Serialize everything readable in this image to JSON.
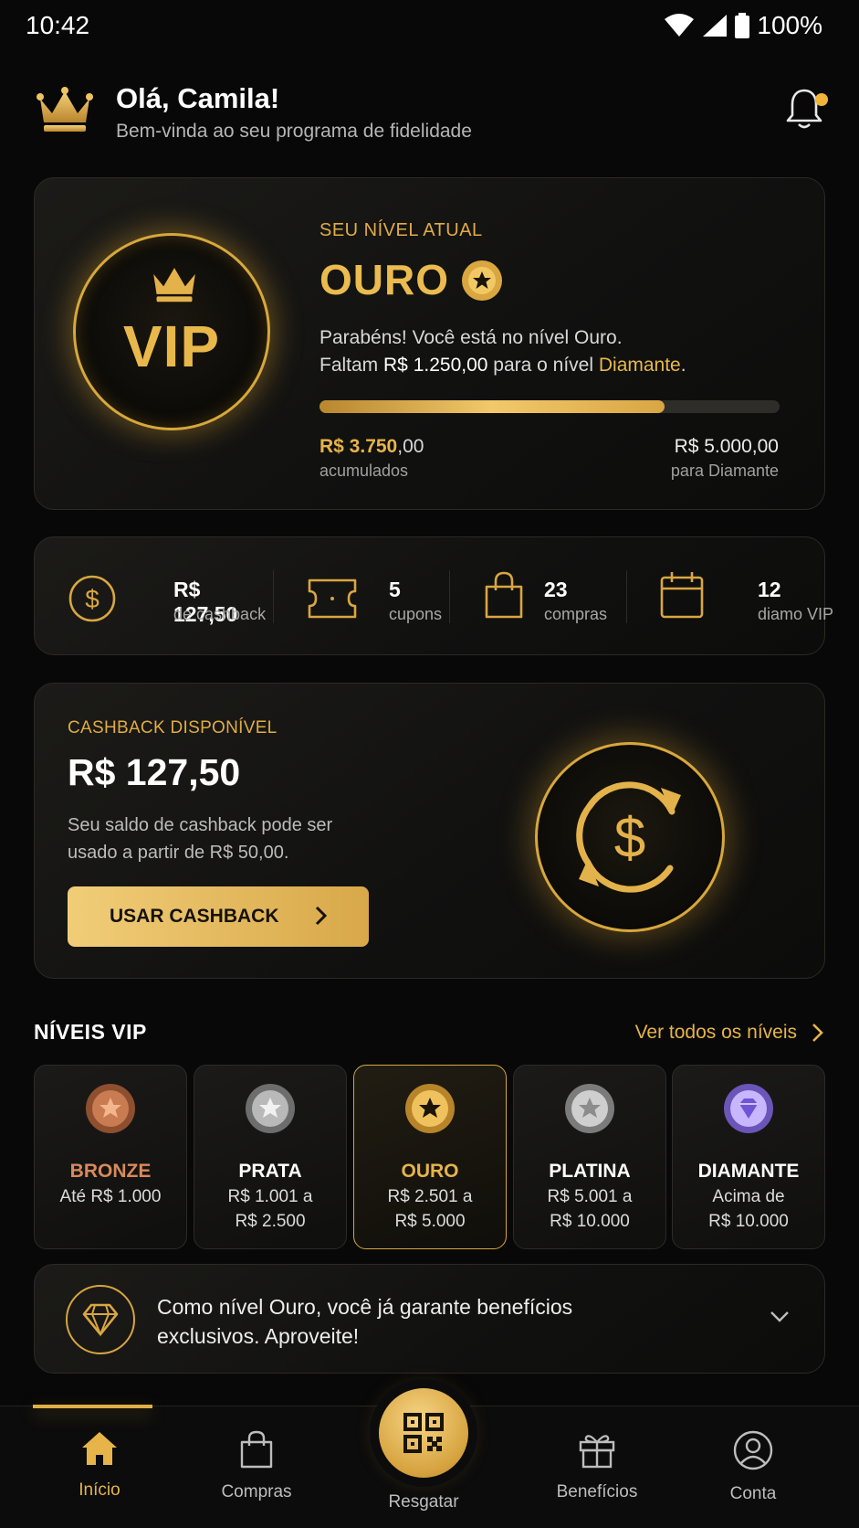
{
  "status_bar": {
    "time": "10:42",
    "battery": "100%"
  },
  "header": {
    "greeting": "Olá, Camila!",
    "subtitle": "Bem-vinda ao seu programa de fidelidade"
  },
  "level_card": {
    "badge_text": "VIP",
    "label": "SEU NÍVEL ATUAL",
    "level_name": "OURO",
    "message_line1": "Parabéns! Você está no nível Ouro.",
    "message_prefix": "Faltam ",
    "missing_amount": "R$ 1.250,00",
    "message_mid": " para o nível ",
    "next_level": "Diamante",
    "message_suffix": ".",
    "progress_fraction": 0.75,
    "accumulated_main": "R$ 3.750",
    "accumulated_dec": ",00",
    "accumulated_label": "acumulados",
    "goal_value": "R$ 5.000,00",
    "goal_label": "para Diamante"
  },
  "stats": [
    {
      "value": "R$ 127,50",
      "label": "de cashback",
      "icon": "dollar-coin-icon"
    },
    {
      "value": "5",
      "label": "cupons",
      "icon": "ticket-icon"
    },
    {
      "value": "23",
      "label": "compras",
      "icon": "shopping-bag-icon"
    },
    {
      "value": "12",
      "label": "diamo VIP",
      "icon": "calendar-icon"
    }
  ],
  "cashback": {
    "label": "CASHBACK DISPONÍVEL",
    "amount": "R$ 127,50",
    "description": "Seu saldo de cashback pode ser usado a partir de R$ 50,00.",
    "button": "USAR CASHBACK"
  },
  "levels_section": {
    "title": "NÍVEIS VIP",
    "link": "Ver todos os níveis",
    "tiers": [
      {
        "name": "BRONZE",
        "range1": "Até R$ 1.000",
        "range2": "",
        "color": "#d98a5a"
      },
      {
        "name": "PRATA",
        "range1": "R$ 1.001 a",
        "range2": "R$ 2.500",
        "color": "#ffffff"
      },
      {
        "name": "OURO",
        "range1": "R$ 2.501 a",
        "range2": "R$ 5.000",
        "color": "#e6b449"
      },
      {
        "name": "PLATINA",
        "range1": "R$ 5.001 a",
        "range2": "R$ 10.000",
        "color": "#ffffff"
      },
      {
        "name": "DIAMANTE",
        "range1": "Acima de",
        "range2": "R$ 10.000",
        "color": "#ffffff"
      }
    ]
  },
  "benefit": {
    "text": "Como nível Ouro, você já garante benefícios exclusivos. Aproveite!"
  },
  "nav": {
    "items": [
      {
        "label": "Início",
        "icon": "home-icon"
      },
      {
        "label": "Compras",
        "icon": "shopping-bag-icon"
      },
      {
        "label": "Resgatar",
        "icon": "qr-code-icon"
      },
      {
        "label": "Benefícios",
        "icon": "gift-icon"
      },
      {
        "label": "Conta",
        "icon": "user-icon"
      }
    ]
  },
  "colors": {
    "accent": "#e6b449",
    "background": "#080808",
    "bronze": "#d98a5a",
    "diamond": "#a98cf0"
  }
}
